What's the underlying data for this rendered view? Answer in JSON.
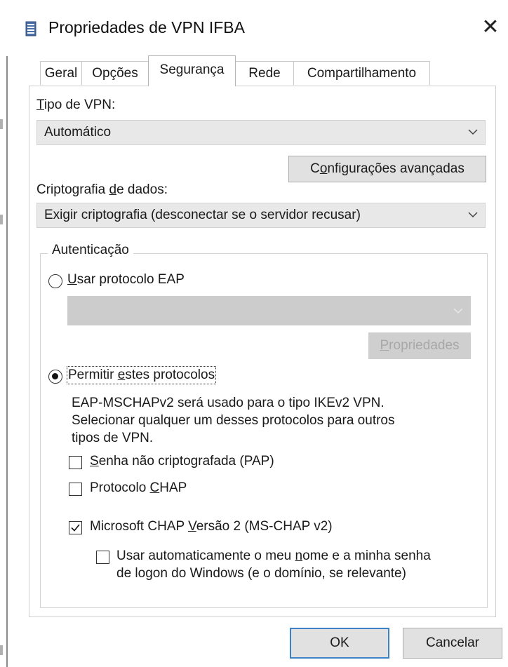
{
  "window": {
    "title": "Propriedades de VPN IFBA",
    "close_glyph": "✕",
    "icon": "document-icon"
  },
  "tabs": [
    {
      "label": "Geral"
    },
    {
      "label": "Opções"
    },
    {
      "label": "Segurança",
      "active": true
    },
    {
      "label": "Rede"
    },
    {
      "label": "Compartilhamento"
    }
  ],
  "security": {
    "vpn_type": {
      "label_accel": "T",
      "label_rest": "ipo de VPN:",
      "value": "Automático"
    },
    "advanced_button": {
      "pre": "C",
      "accel": "o",
      "post": "nfigurações avançadas"
    },
    "encryption": {
      "label_pre": "Criptografia ",
      "label_accel": "d",
      "label_post": "e dados:",
      "value": "Exigir criptografia (desconectar se o servidor recusar)"
    },
    "auth": {
      "title": "Autenticação",
      "eap_radio": {
        "accel": "U",
        "rest": "sar protocolo EAP",
        "selected": false
      },
      "eap_combo_value": "",
      "properties_button": {
        "accel": "P",
        "rest": "ropriedades"
      },
      "allow_radio": {
        "pre": "Permitir ",
        "accel": "e",
        "post": "stes protocolos",
        "selected": true
      },
      "info_lines": [
        "EAP-MSCHAPv2 será usado para o tipo IKEv2 VPN.",
        "Selecionar qualquer um desses protocolos para outros",
        "tipos de VPN."
      ],
      "pap": {
        "accel": "S",
        "rest": "enha não criptografada (PAP)",
        "checked": false
      },
      "chap": {
        "pre": "Protocolo ",
        "accel": "C",
        "post": "HAP",
        "checked": false
      },
      "mschap": {
        "pre": "Microsoft CHAP ",
        "accel": "V",
        "post": "ersão 2 (MS-CHAP v2)",
        "checked": true
      },
      "autologon": {
        "line1_pre": "Usar automaticamente o meu ",
        "line1_accel": "n",
        "line1_post": "ome e a minha senha",
        "line2": "de logon do Windows (e o domínio, se relevante)",
        "checked": false
      }
    }
  },
  "footer": {
    "ok_label": "OK",
    "cancel_label": "Cancelar"
  }
}
